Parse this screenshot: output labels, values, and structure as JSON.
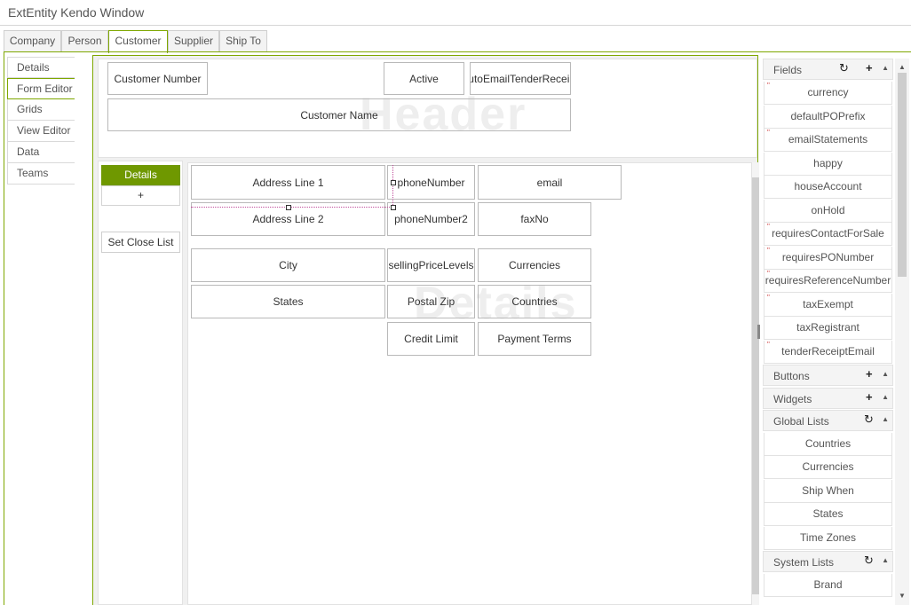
{
  "window": {
    "title": "ExtEntity Kendo Window"
  },
  "tabs": [
    {
      "label": "Company"
    },
    {
      "label": "Person"
    },
    {
      "label": "Customer"
    },
    {
      "label": "Supplier"
    },
    {
      "label": "Ship To"
    }
  ],
  "active_tab": "Customer",
  "sidenav": [
    {
      "label": "Details"
    },
    {
      "label": "Form Editor"
    },
    {
      "label": "Grids"
    },
    {
      "label": "View Editor"
    },
    {
      "label": "Data"
    },
    {
      "label": "Teams"
    }
  ],
  "active_sidenav": "Form Editor",
  "header_section": {
    "watermark": "Header",
    "fields": {
      "customer_number": "Customer Number",
      "active": "Active",
      "auto_email": "autoEmailTenderReceipt",
      "customer_name": "Customer Name"
    }
  },
  "details_section": {
    "watermark": "Details",
    "details_button": "Details",
    "plus_button": "+",
    "set_close_list_button": "Set Close List",
    "fields": {
      "address_line_1": "Address Line 1",
      "phone_number": "phoneNumber",
      "email": "email",
      "address_line_2": "Address Line 2",
      "phone_number2": "phoneNumber2",
      "fax_no": "faxNo",
      "city": "City",
      "selling_price_levels": "sellingPriceLevels",
      "currencies": "Currencies",
      "states": "States",
      "postal_zip": "Postal Zip",
      "countries": "Countries",
      "credit_limit": "Credit Limit",
      "payment_terms": "Payment Terms"
    }
  },
  "right_panel": {
    "fields": {
      "label": "Fields",
      "refresh_icon": "refresh-icon",
      "add_icon": "plus-icon",
      "items": [
        {
          "label": "currency",
          "marked": true
        },
        {
          "label": "defaultPOPrefix",
          "marked": false
        },
        {
          "label": "emailStatements",
          "marked": true
        },
        {
          "label": "happy",
          "marked": false
        },
        {
          "label": "houseAccount",
          "marked": false
        },
        {
          "label": "onHold",
          "marked": false
        },
        {
          "label": "requiresContactForSale",
          "marked": true
        },
        {
          "label": "requiresPONumber",
          "marked": true
        },
        {
          "label": "requiresReferenceNumber",
          "marked": true
        },
        {
          "label": "taxExempt",
          "marked": true
        },
        {
          "label": "taxRegistrant",
          "marked": false
        },
        {
          "label": "tenderReceiptEmail",
          "marked": true
        }
      ]
    },
    "buttons": {
      "label": "Buttons"
    },
    "widgets": {
      "label": "Widgets"
    },
    "global_lists": {
      "label": "Global Lists",
      "items": [
        {
          "label": "Countries"
        },
        {
          "label": "Currencies"
        },
        {
          "label": "Ship When"
        },
        {
          "label": "States"
        },
        {
          "label": "Time Zones"
        }
      ]
    },
    "system_lists": {
      "label": "System Lists",
      "items": [
        {
          "label": "Brand"
        }
      ]
    }
  },
  "colors": {
    "accent": "#7ea700",
    "details_button": "#6f9800",
    "field_marker": "#cc3333"
  }
}
